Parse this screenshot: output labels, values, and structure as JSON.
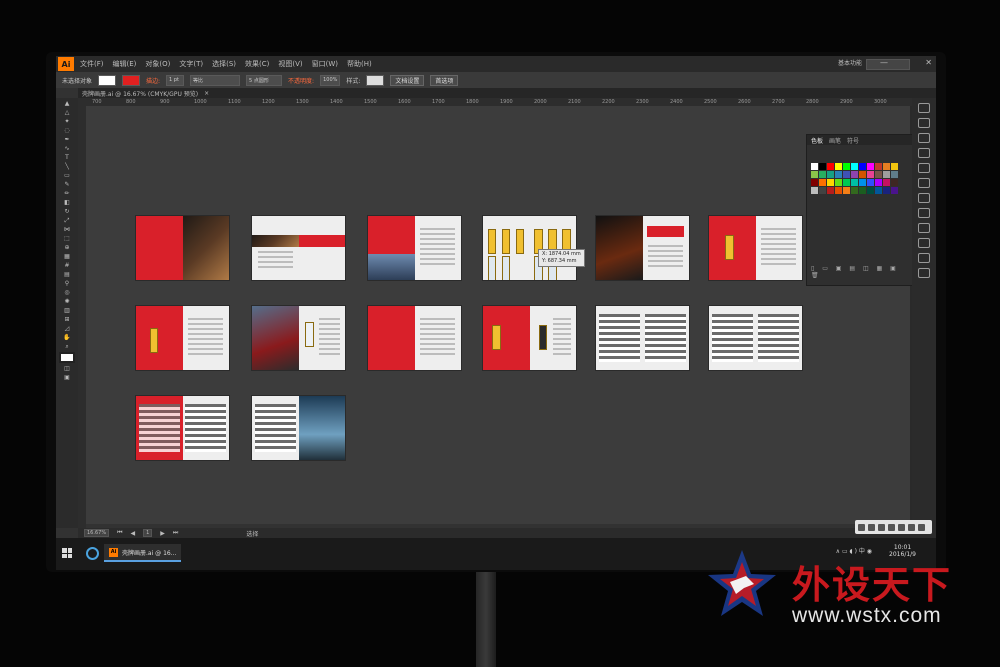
{
  "app": {
    "logo_text": "Ai",
    "menu": [
      "文件(F)",
      "编辑(E)",
      "对象(O)",
      "文字(T)",
      "选择(S)",
      "效果(C)",
      "视图(V)",
      "窗口(W)",
      "帮助(H)"
    ],
    "workspace_label": "基本功能",
    "window_controls": [
      "—",
      "□",
      "✕"
    ]
  },
  "control_bar": {
    "selection_label": "未选择对象",
    "stroke_label": "描边:",
    "stroke_value": "1 pt",
    "stroke_style": "等比",
    "brush_label": "5 点圆形",
    "opacity_label": "不透明度:",
    "opacity_value": "100%",
    "style_label": "样式:",
    "doc_setup_button": "文档设置",
    "prefs_button": "首选项"
  },
  "document_tab": {
    "title": "壳牌画册.ai @ 16.67% (CMYK/GPU 预览)",
    "close_icon": "×"
  },
  "ruler_ticks": [
    "700",
    "800",
    "900",
    "1000",
    "1100",
    "1200",
    "1300",
    "1400",
    "1500",
    "1600",
    "1700",
    "1800",
    "1900",
    "2000",
    "2100",
    "2200",
    "2300",
    "2400",
    "2500",
    "2600",
    "2700",
    "2800",
    "2900",
    "3000"
  ],
  "cursor_tooltip": {
    "x_line": "X: 1874.04 mm",
    "y_line": "Y: 687.34 mm"
  },
  "swatches_panel": {
    "tabs": [
      "色板",
      "画笔",
      "符号"
    ],
    "colors": [
      "#ffffff",
      "#000000",
      "#ff0000",
      "#ffff00",
      "#00ff00",
      "#00ffff",
      "#0000ff",
      "#ff00ff",
      "#c0392b",
      "#e67e22",
      "#f1c40f",
      "#8bc34a",
      "#27ae60",
      "#16a085",
      "#2980b9",
      "#3f51b5",
      "#8e44ad",
      "#d35400",
      "#e84393",
      "#795548",
      "#9e9e9e",
      "#607d8b",
      "#7f0000",
      "#ff6f00",
      "#ffd600",
      "#64dd17",
      "#00c853",
      "#00bfa5",
      "#0091ea",
      "#304ffe",
      "#aa00ff",
      "#c51162",
      "#3e2723",
      "#bdbdbd",
      "#424242",
      "#b71c1c",
      "#e65100",
      "#f57f17",
      "#33691e",
      "#1b5e20",
      "#004d40",
      "#01579b",
      "#1a237e",
      "#4a148c"
    ],
    "footer_icons": "▯ ▭ ▣ ▤ ◫ ▦ ▣ 🗑"
  },
  "status_bar": {
    "zoom": "16.67%",
    "page": "1",
    "mode": "选择"
  },
  "taskbar": {
    "app_label": "壳牌画册.ai @ 16...",
    "app_icon_text": "Ai",
    "tray_icons": "∧  ▭  ◖ )  中  ◉",
    "time": "10:01",
    "date": "2016/1/9"
  },
  "watermark": {
    "brand": "外设天下",
    "url": "www.wstx.com"
  }
}
